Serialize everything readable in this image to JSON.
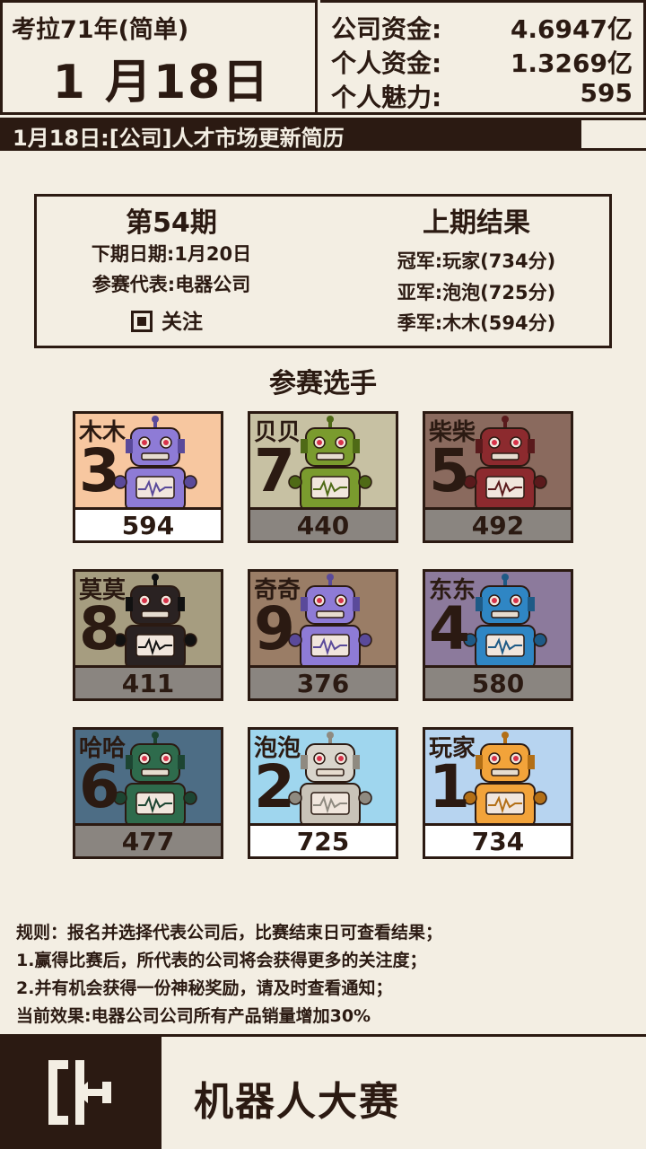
{
  "header": {
    "year": "考拉71年(简单)",
    "date": "1 月18日",
    "company_funds_label": "公司资金:",
    "company_funds": "4.6947亿",
    "personal_funds_label": "个人资金:",
    "personal_funds": "1.3269亿",
    "charm_label": "个人魅力:",
    "charm": "595"
  },
  "ticker": {
    "message": "1月18日:[公司]人才市场更新简历"
  },
  "contest": {
    "issue": "第54期",
    "next_date": "下期日期:1月20日",
    "representative": "参赛代表:电器公司",
    "follow_label": "关注",
    "follow_checked": true,
    "last_results_title": "上期结果",
    "champion": "冠军:玩家(734分)",
    "runner_up": "亚军:泡泡(725分)",
    "third": "季军:木木(594分)"
  },
  "players_title": "参赛选手",
  "players": [
    {
      "name": "木木",
      "number": "3",
      "score": "594",
      "bg": "#f7c7a0",
      "robot": "purple",
      "highlight": true
    },
    {
      "name": "贝贝",
      "number": "7",
      "score": "440",
      "bg": "#c7c1a3",
      "robot": "green",
      "highlight": false
    },
    {
      "name": "柴柴",
      "number": "5",
      "score": "492",
      "bg": "#8a6a5e",
      "robot": "red",
      "highlight": false
    },
    {
      "name": "莫莫",
      "number": "8",
      "score": "411",
      "bg": "#a69d80",
      "robot": "black",
      "highlight": false
    },
    {
      "name": "奇奇",
      "number": "9",
      "score": "376",
      "bg": "#9a7d66",
      "robot": "purple",
      "highlight": false
    },
    {
      "name": "东东",
      "number": "4",
      "score": "580",
      "bg": "#8c7a9c",
      "robot": "blue",
      "highlight": false
    },
    {
      "name": "哈哈",
      "number": "6",
      "score": "477",
      "bg": "#4d6d85",
      "robot": "teal",
      "highlight": false
    },
    {
      "name": "泡泡",
      "number": "2",
      "score": "725",
      "bg": "#9fd6ee",
      "robot": "silver",
      "highlight": true
    },
    {
      "name": "玩家",
      "number": "1",
      "score": "734",
      "bg": "#b7d4f0",
      "robot": "orange",
      "highlight": true
    }
  ],
  "rules": {
    "line1": "规则：报名并选择代表公司后，比赛结束日可查看结果；",
    "line2": "1.赢得比赛后，所代表的公司将会获得更多的关注度；",
    "line3": "2.并有机会获得一份神秘奖励，请及时查看通知；",
    "line4": "当前效果:电器公司公司所有产品销量增加30%"
  },
  "footer": {
    "title": "机器人大赛",
    "exit_icon": "exit-door-icon"
  }
}
